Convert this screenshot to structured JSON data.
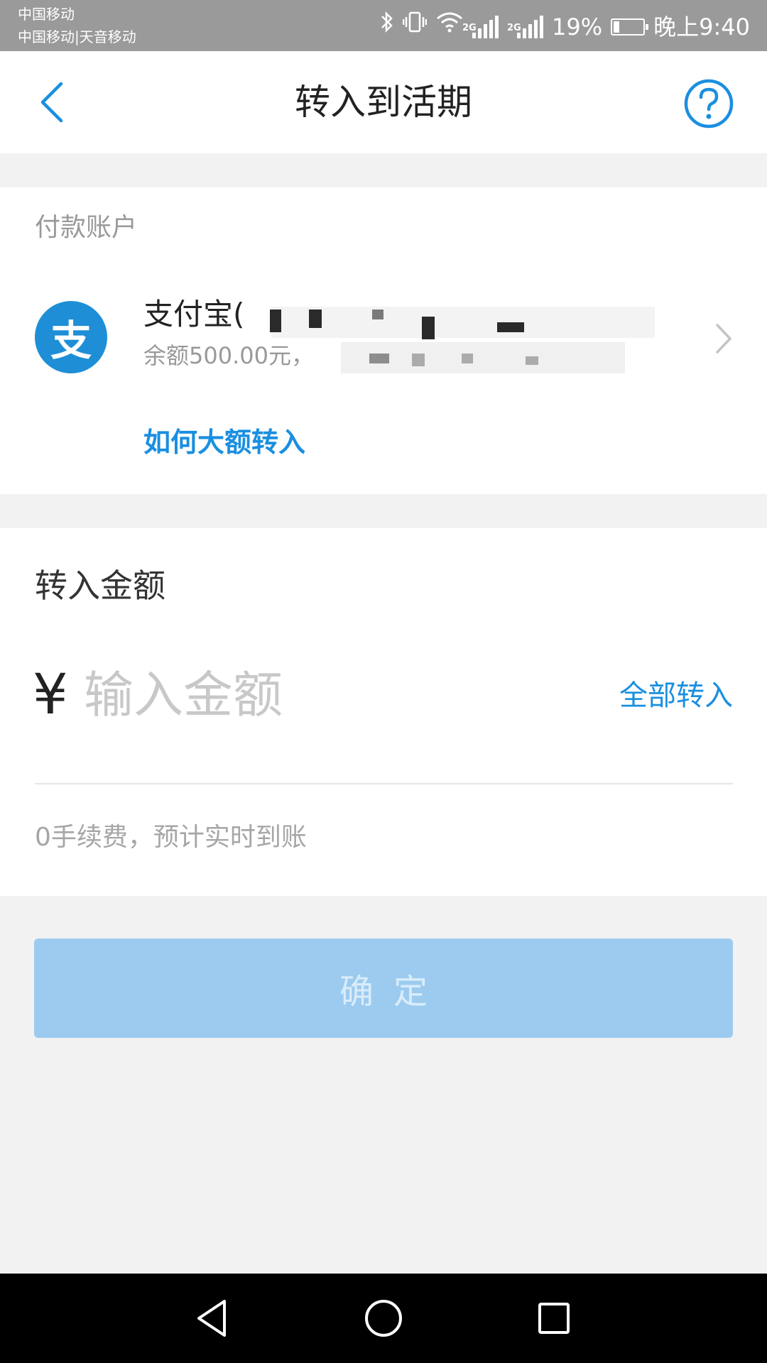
{
  "status_bar": {
    "carrier_line1": "中国移动",
    "carrier_line2": "中国移动|天音移动",
    "network_tag_1": "2G",
    "network_tag_2": "2G",
    "battery_percent": "19%",
    "battery_level": 0.19,
    "time": "晚上9:40",
    "icons": [
      "bluetooth-icon",
      "vibrate-icon",
      "wifi-icon",
      "signal-icon",
      "signal-icon",
      "battery-icon"
    ]
  },
  "header": {
    "title": "转入到活期",
    "back_icon": "chevron-left-icon",
    "help_icon": "question-circle-icon"
  },
  "account_section": {
    "label": "付款账户",
    "account_name": "支付宝(",
    "balance_text": "余额500.00元，",
    "logo_glyph": "支",
    "large_transfer_link": "如何大额转入"
  },
  "amount_section": {
    "label": "转入金额",
    "currency_symbol": "¥",
    "input_placeholder": "输入金额",
    "input_value": "",
    "transfer_all": "全部转入",
    "fee_note": "0手续费，预计实时到账"
  },
  "confirm_button": {
    "label": "确定"
  },
  "colors": {
    "accent": "#1a8fe0",
    "alipay_blue": "#1e8fd6",
    "button_disabled": "#9ccbef",
    "page_bg": "#f2f2f2"
  }
}
